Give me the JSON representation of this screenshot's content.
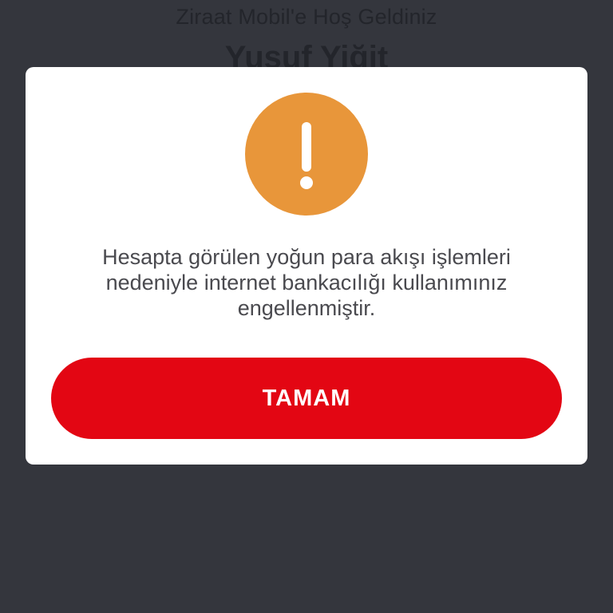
{
  "background": {
    "welcome_text": "Ziraat Mobil'e Hoş Geldiniz",
    "user_name": "Yusuf Yiğit"
  },
  "dialog": {
    "icon": "warning-exclamation-icon",
    "message_lines": [
      "Hesapta görülen yoğun para akışı işlemleri",
      "nedeniyle internet bankacılığı kullanımınız",
      "engellenmiştir."
    ],
    "ok_label": "TAMAM"
  },
  "colors": {
    "overlay_background": "#34363d",
    "dialog_background": "#ffffff",
    "warning_orange": "#e8963a",
    "button_red": "#e30613",
    "message_text": "#4a4a4f"
  }
}
